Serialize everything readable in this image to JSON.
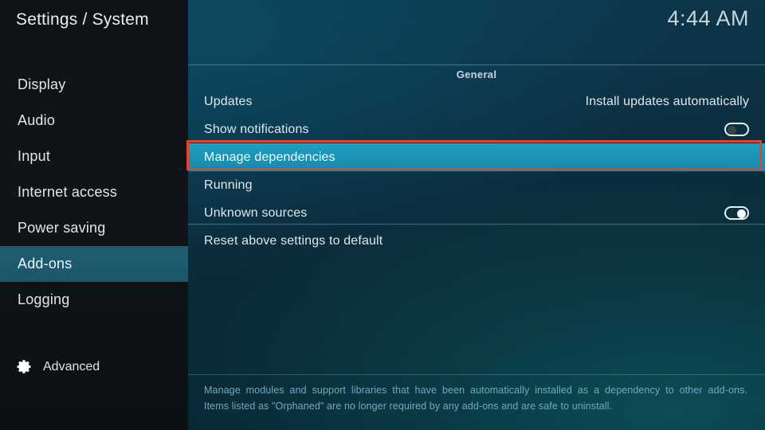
{
  "window": {
    "title": "Settings / System",
    "clock": "4:44 AM"
  },
  "sidebar": {
    "items": [
      {
        "label": "Display",
        "selected": false
      },
      {
        "label": "Audio",
        "selected": false
      },
      {
        "label": "Input",
        "selected": false
      },
      {
        "label": "Internet access",
        "selected": false
      },
      {
        "label": "Power saving",
        "selected": false
      },
      {
        "label": "Add-ons",
        "selected": true
      },
      {
        "label": "Logging",
        "selected": false
      }
    ],
    "advanced": {
      "label": "Advanced",
      "icon": "gear-icon"
    }
  },
  "main": {
    "group_label": "General",
    "rows": [
      {
        "label": "Updates",
        "value": "Install updates automatically",
        "control": "text",
        "highlighted": false
      },
      {
        "label": "Show notifications",
        "value": "off",
        "control": "toggle",
        "highlighted": false
      },
      {
        "label": "Manage dependencies",
        "value": "",
        "control": "none",
        "highlighted": true
      },
      {
        "label": "Running",
        "value": "",
        "control": "none",
        "highlighted": false
      },
      {
        "label": "Unknown sources",
        "value": "on",
        "control": "toggle",
        "highlighted": false
      },
      {
        "label": "Reset above settings to default",
        "value": "",
        "control": "none",
        "highlighted": false
      }
    ]
  },
  "info": {
    "line1": "Manage modules and support libraries that have been automatically installed as a dependency to other add-ons.",
    "line2": "Items listed as \"Orphaned\" are no longer required by any add-ons and are safe to uninstall."
  },
  "colors": {
    "accent_highlight": "#1b93b4",
    "sidebar_selected": "#1e5f72",
    "annotation": "#e8412a",
    "info_text": "#6fa9c4"
  }
}
